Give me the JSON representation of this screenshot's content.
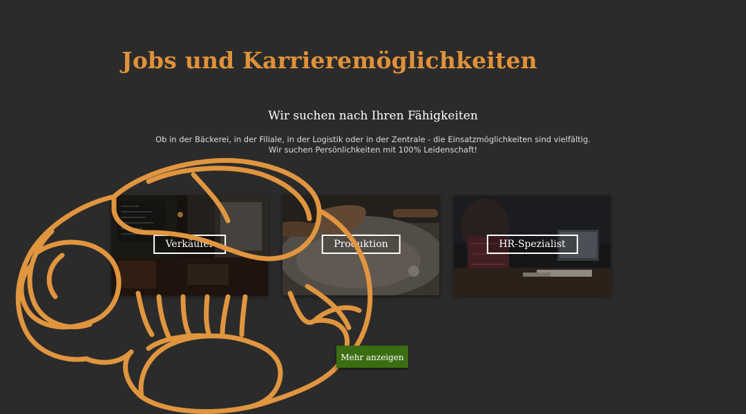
{
  "header": {
    "title": "Jobs und Karrieremöglichkeiten"
  },
  "section": {
    "subtitle": "Wir suchen nach Ihren Fähigkeiten",
    "intro_line1": "Ob in der Bäckerei, in der Filiale, in der Logistik oder in der Zentrale - die Einsatzmöglichkeiten sind vielfältig.",
    "intro_line2": "Wir suchen Persönlichkeiten mit 100% Leidenschaft!"
  },
  "cards": [
    {
      "label": "Verkäufer"
    },
    {
      "label": "Produktion"
    },
    {
      "label": "HR-Spezialist"
    }
  ],
  "actions": {
    "more_label": "Mehr anzeigen"
  },
  "colors": {
    "background": "#2b2b2b",
    "accent": "#e0913a",
    "button": "#3b6d12"
  }
}
